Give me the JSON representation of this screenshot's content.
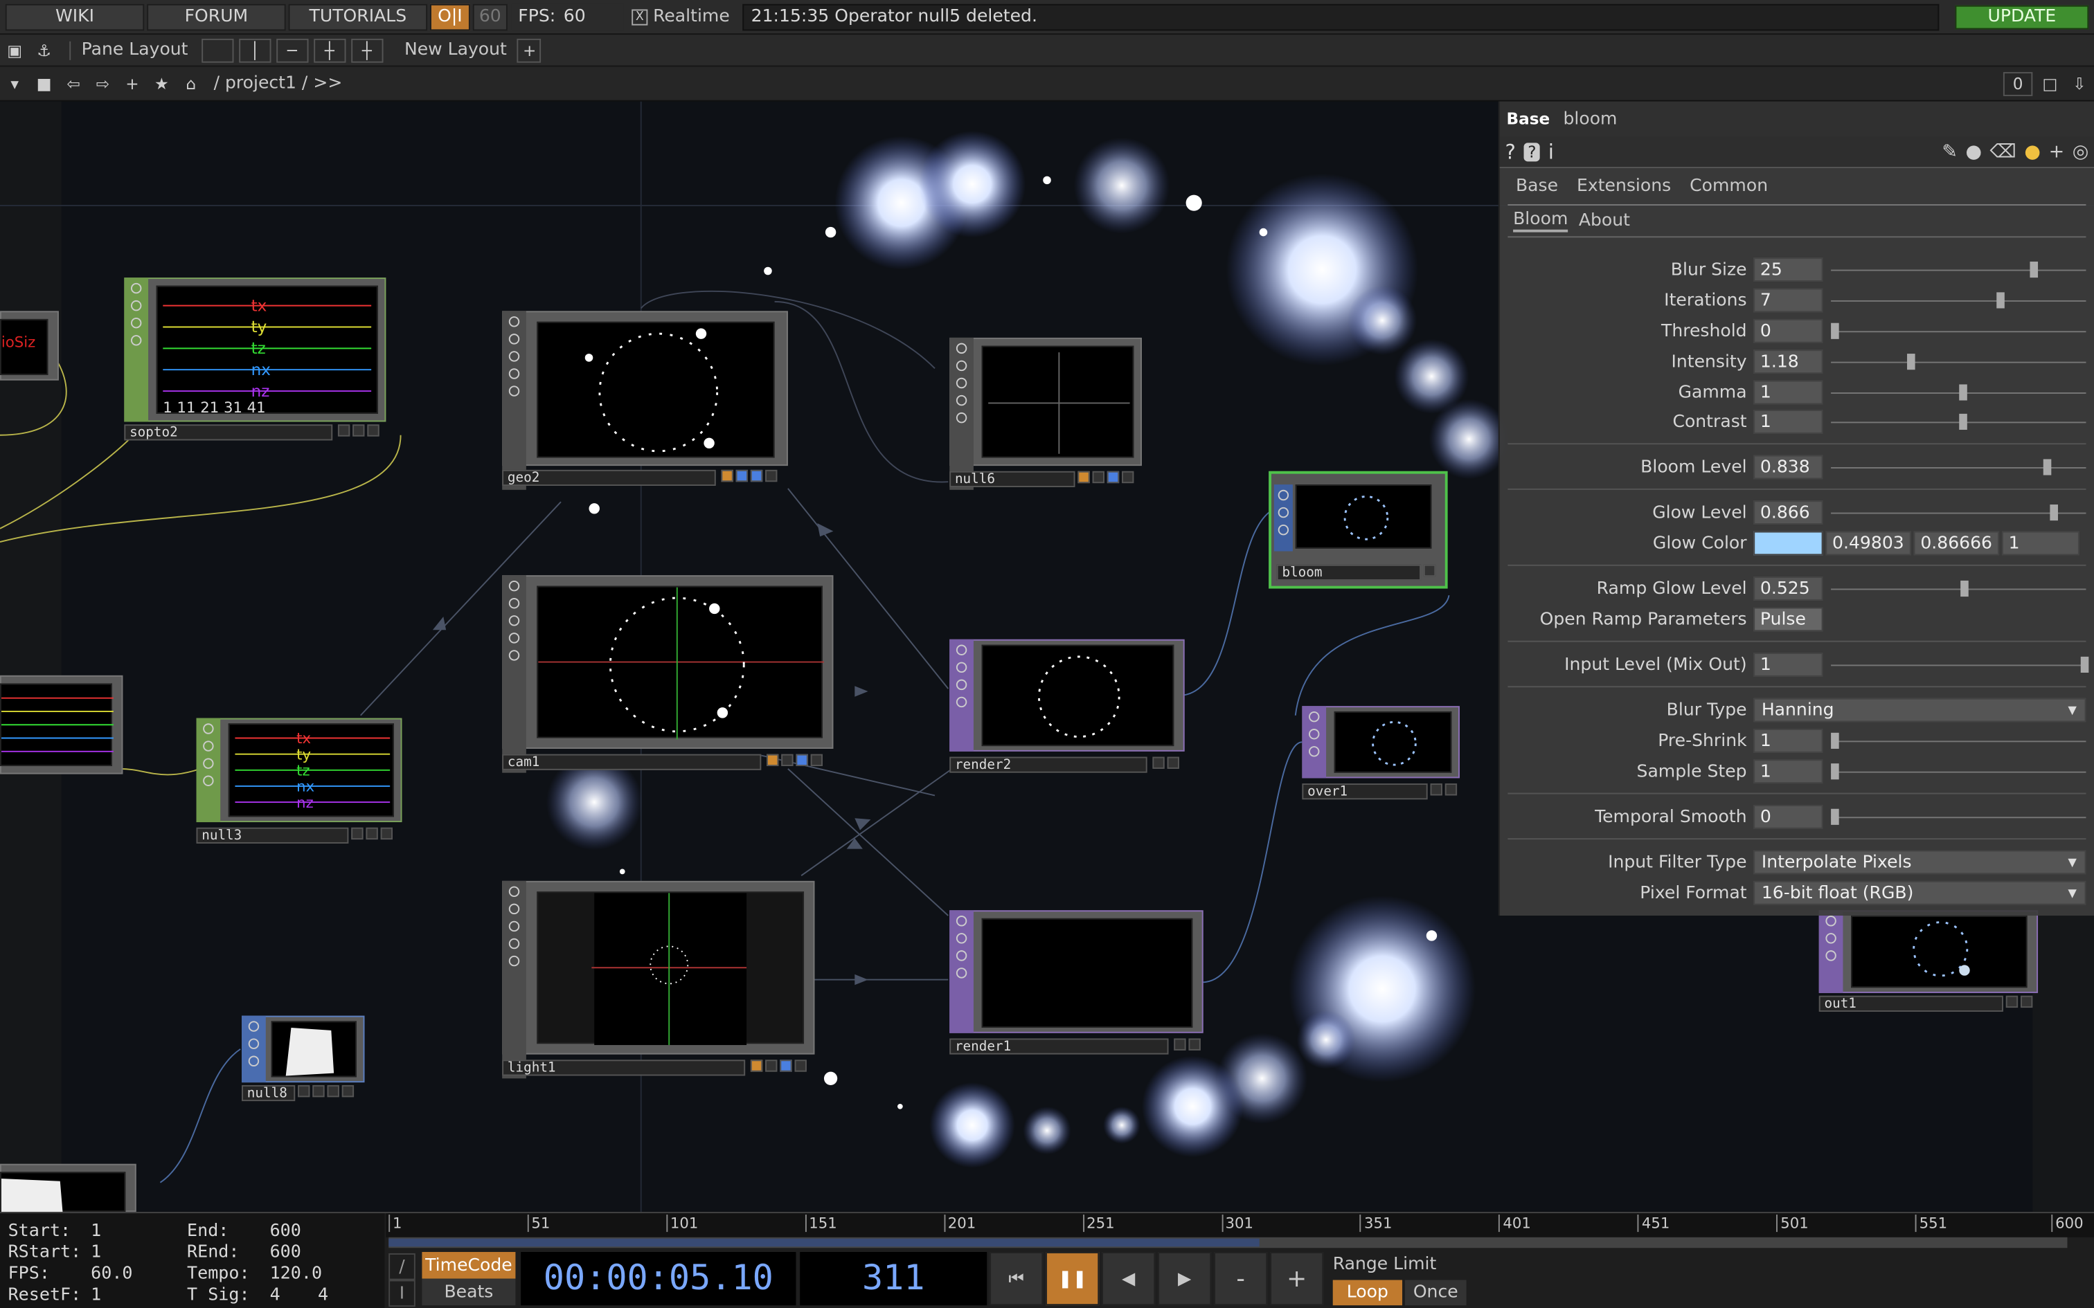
{
  "topbar": {
    "wiki": "WIKI",
    "forum": "FORUM",
    "tutorials": "TUTORIALS",
    "oi": "O|I",
    "fps_cap": "60",
    "fps_label": "FPS:",
    "fps_value": "60",
    "realtime_check": "X",
    "realtime_label": "Realtime",
    "status": "21:15:35 Operator null5 deleted.",
    "update": "UPDATE"
  },
  "bar2": {
    "pane_layout": "Pane Layout",
    "new_layout": "New Layout",
    "plus": "+"
  },
  "bar3": {
    "path": "/ project1 / >>",
    "counter": "0"
  },
  "nodes": {
    "sopto2": "sopto2",
    "geo2": "geo2",
    "null6": "null6",
    "bloom": "bloom",
    "cam1": "cam1",
    "render2": "render2",
    "over1": "over1",
    "null3": "null3",
    "light1": "light1",
    "render1": "render1",
    "null8": "null8",
    "out1": "out1"
  },
  "panel": {
    "type": "Base",
    "name": "bloom",
    "tabs": [
      "Base",
      "Extensions",
      "Common"
    ],
    "subtabs": [
      "Bloom",
      "About"
    ],
    "params": {
      "blur_size": {
        "label": "Blur Size",
        "value": "25"
      },
      "iterations": {
        "label": "Iterations",
        "value": "7"
      },
      "threshold": {
        "label": "Threshold",
        "value": "0"
      },
      "intensity": {
        "label": "Intensity",
        "value": "1.18"
      },
      "gamma": {
        "label": "Gamma",
        "value": "1"
      },
      "contrast": {
        "label": "Contrast",
        "value": "1"
      },
      "bloom_level": {
        "label": "Bloom Level",
        "value": "0.838"
      },
      "glow_level": {
        "label": "Glow Level",
        "value": "0.866"
      },
      "glow_color": {
        "label": "Glow Color",
        "r": "0.49803",
        "g": "0.86666",
        "b": "1",
        "swatch": "#9fd4ff"
      },
      "ramp_glow_level": {
        "label": "Ramp Glow Level",
        "value": "0.525"
      },
      "open_ramp": {
        "label": "Open Ramp Parameters",
        "value": "Pulse"
      },
      "input_level": {
        "label": "Input Level (Mix Out)",
        "value": "1"
      },
      "blur_type": {
        "label": "Blur Type",
        "value": "Hanning"
      },
      "pre_shrink": {
        "label": "Pre-Shrink",
        "value": "1"
      },
      "sample_step": {
        "label": "Sample Step",
        "value": "1"
      },
      "temporal_smooth": {
        "label": "Temporal Smooth",
        "value": "0"
      },
      "input_filter": {
        "label": "Input Filter Type",
        "value": "Interpolate Pixels"
      },
      "pixel_format": {
        "label": "Pixel Format",
        "value": "16-bit float (RGB)"
      }
    }
  },
  "timeline": {
    "start_label": "Start:",
    "start": "1",
    "end_label": "End:",
    "end": "600",
    "rstart_label": "RStart:",
    "rstart": "1",
    "rend_label": "REnd:",
    "rend": "600",
    "fps_label": "FPS:",
    "fps": "60.0",
    "tempo_label": "Tempo:",
    "tempo": "120.0",
    "resetf_label": "ResetF:",
    "resetf": "1",
    "tsig_label": "T Sig:",
    "tsig_a": "4",
    "tsig_b": "4",
    "ticks": [
      "1",
      "51",
      "101",
      "151",
      "201",
      "251",
      "301",
      "351",
      "401",
      "451",
      "501",
      "551",
      "600"
    ],
    "timecode_btn": "TimeCode",
    "beats_btn": "Beats",
    "timecode": "00:00:05.10",
    "frame": "311",
    "minus": "-",
    "plus": "+",
    "range_limit": "Range Limit",
    "loop": "Loop",
    "once": "Once",
    "current_frame": 311
  }
}
